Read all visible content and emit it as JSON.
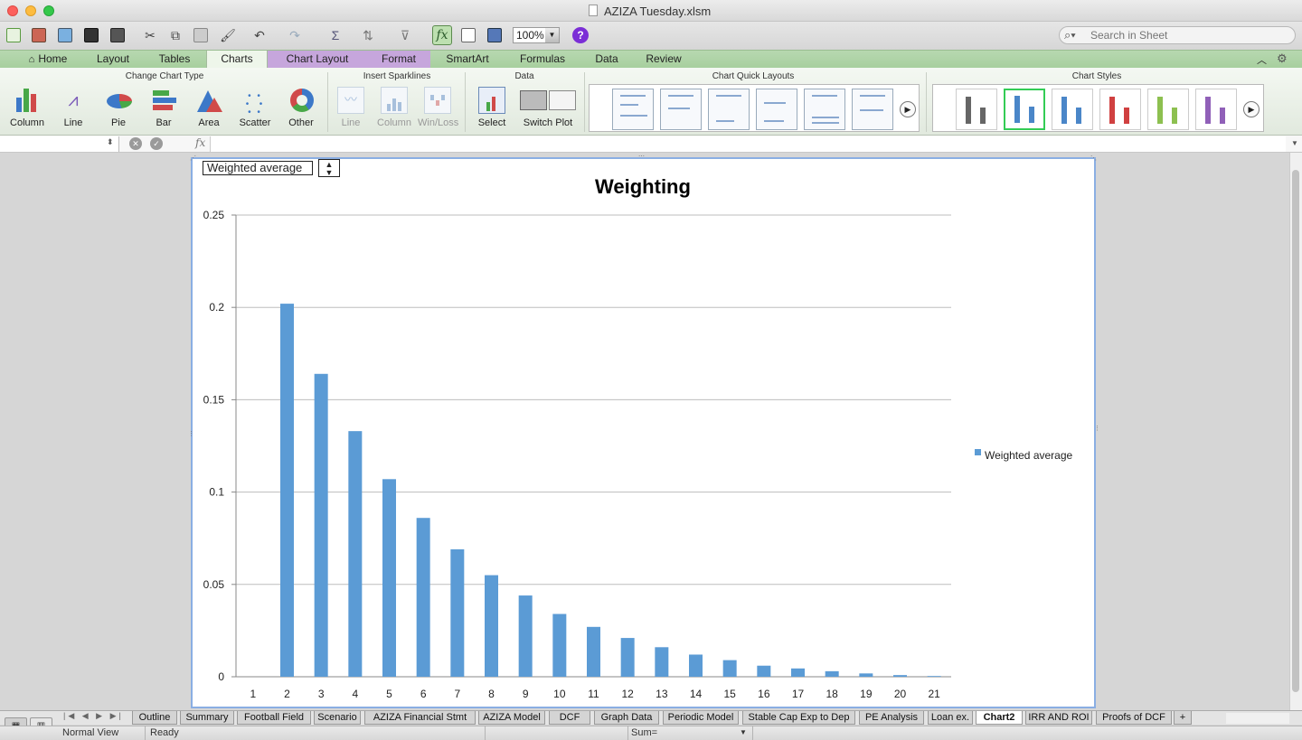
{
  "window": {
    "title": "AZIZA Tuesday.xlsm"
  },
  "toolbar": {
    "zoom": "100%",
    "search_placeholder": "Search in Sheet"
  },
  "ribbon_tabs": [
    "Home",
    "Layout",
    "Tables",
    "Charts",
    "Chart Layout",
    "Format",
    "SmartArt",
    "Formulas",
    "Data",
    "Review"
  ],
  "ribbon": {
    "groups": {
      "change_chart_type": "Change Chart Type",
      "insert_sparklines": "Insert Sparklines",
      "data": "Data",
      "quick_layouts": "Chart Quick Layouts",
      "chart_styles": "Chart Styles"
    },
    "chart_types": [
      "Column",
      "Line",
      "Pie",
      "Bar",
      "Area",
      "Scatter",
      "Other"
    ],
    "sparklines": [
      "Line",
      "Column",
      "Win/Loss"
    ],
    "data_buttons": [
      "Select",
      "Switch Plot"
    ],
    "style_colors": [
      "#666666",
      "#4a86c8",
      "#4a86c8",
      "#d04040",
      "#8dc050",
      "#9060b8"
    ]
  },
  "formula_bar": {
    "fx": "fx"
  },
  "chart": {
    "dropdown": "Weighted average",
    "title": "Weighting",
    "legend": "Weighted average",
    "bar_color": "#5b9bd5"
  },
  "chart_data": {
    "type": "bar",
    "title": "Weighting",
    "categories": [
      "1",
      "2",
      "3",
      "4",
      "5",
      "6",
      "7",
      "8",
      "9",
      "10",
      "11",
      "12",
      "13",
      "14",
      "15",
      "16",
      "17",
      "18",
      "19",
      "20",
      "21"
    ],
    "series": [
      {
        "name": "Weighted average",
        "values": [
          0,
          0.202,
          0.164,
          0.133,
          0.107,
          0.086,
          0.069,
          0.055,
          0.044,
          0.034,
          0.027,
          0.021,
          0.016,
          0.012,
          0.009,
          0.006,
          0.0045,
          0.003,
          0.0018,
          0.0009,
          0.0004
        ]
      }
    ],
    "yticks": [
      "0",
      "0.05",
      "0.1",
      "0.15",
      "0.2",
      "0.25"
    ],
    "ylim": [
      0,
      0.25
    ],
    "grid": true,
    "legend_position": "right"
  },
  "sheet_tabs": [
    "Outline",
    "Summary",
    "Football Field",
    "Scenario",
    "AZIZA Financial Stmt",
    "AZIZA Model",
    "DCF",
    "Graph Data",
    "Periodic Model",
    "Stable Cap Exp to Dep",
    "PE Analysis",
    "Loan ex.",
    "Chart2",
    "IRR AND ROI",
    "Proofs of DCF"
  ],
  "active_sheet": "Chart2",
  "add_sheet": "+",
  "status": {
    "view": "Normal View",
    "state": "Ready",
    "sum": "Sum="
  }
}
